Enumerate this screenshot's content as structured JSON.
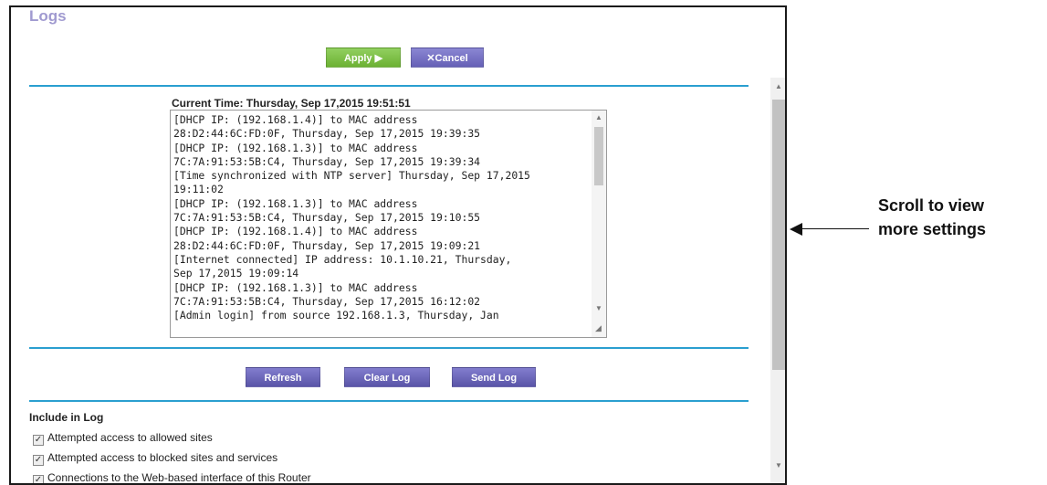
{
  "page": {
    "title": "Logs"
  },
  "toolbar": {
    "apply_label": "Apply ▶",
    "cancel_label": "✕Cancel"
  },
  "log": {
    "current_time": "Current Time: Thursday, Sep 17,2015 19:51:51",
    "lines": [
      "[DHCP IP: (192.168.1.4)] to MAC address",
      "28:D2:44:6C:FD:0F, Thursday, Sep 17,2015 19:39:35",
      "[DHCP IP: (192.168.1.3)] to MAC address",
      "7C:7A:91:53:5B:C4, Thursday, Sep 17,2015 19:39:34",
      "[Time synchronized with NTP server] Thursday, Sep 17,2015",
      "19:11:02",
      "[DHCP IP: (192.168.1.3)] to MAC address",
      "7C:7A:91:53:5B:C4, Thursday, Sep 17,2015 19:10:55",
      "[DHCP IP: (192.168.1.4)] to MAC address",
      "28:D2:44:6C:FD:0F, Thursday, Sep 17,2015 19:09:21",
      "[Internet connected] IP address: 10.1.10.21, Thursday,",
      "Sep 17,2015 19:09:14",
      "[DHCP IP: (192.168.1.3)] to MAC address",
      "7C:7A:91:53:5B:C4, Thursday, Sep 17,2015 16:12:02",
      "[Admin login] from source 192.168.1.3, Thursday, Jan"
    ]
  },
  "actions": {
    "refresh_label": "Refresh",
    "clear_label": "Clear Log",
    "send_label": "Send Log"
  },
  "include": {
    "heading": "Include in Log",
    "options": [
      {
        "label": "Attempted access to allowed sites",
        "checked": true
      },
      {
        "label": "Attempted access to blocked sites and services",
        "checked": true
      },
      {
        "label": "Connections to the Web-based interface of this Router",
        "checked": true
      }
    ]
  },
  "annotation": {
    "line1": "Scroll to view",
    "line2": "more settings"
  },
  "colors": {
    "title": "#a09ad0",
    "apply": "#7cbf45",
    "purple": "#6f6ac0",
    "divider": "#2a9fd0"
  }
}
